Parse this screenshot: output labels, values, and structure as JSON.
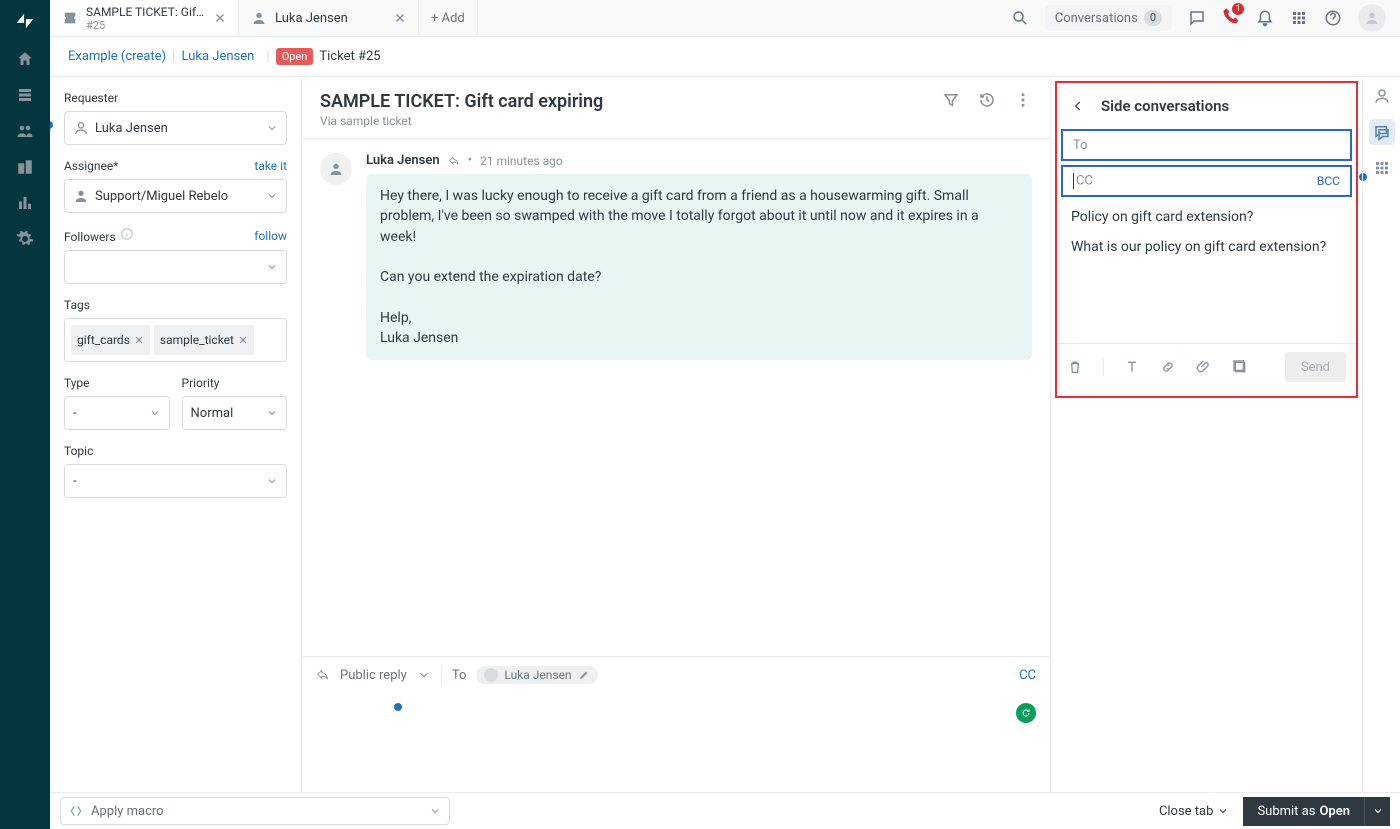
{
  "tabs": {
    "ticket_title": "SAMPLE TICKET: Gift car…",
    "ticket_sub": "#25",
    "user_title": "Luka Jensen",
    "add_label": "+  Add"
  },
  "topbar": {
    "conversations_label": "Conversations",
    "conversations_count": "0",
    "phone_badge": "1"
  },
  "breadcrumb": {
    "project": "Example (create)",
    "user": "Luka Jensen",
    "badge": "Open",
    "ticket": "Ticket #25"
  },
  "props": {
    "requester_label": "Requester",
    "requester_value": "Luka Jensen",
    "assignee_label": "Assignee*",
    "take_it": "take it",
    "assignee_value": "Support/Miguel Rebelo",
    "followers_label": "Followers",
    "follow": "follow",
    "tags_label": "Tags",
    "tags": [
      "gift_cards",
      "sample_ticket"
    ],
    "type_label": "Type",
    "type_value": "-",
    "priority_label": "Priority",
    "priority_value": "Normal",
    "topic_label": "Topic",
    "topic_value": "-"
  },
  "ticket": {
    "title": "SAMPLE TICKET: Gift card expiring",
    "via": "Via sample ticket"
  },
  "message": {
    "author": "Luka Jensen",
    "time": "21 minutes ago",
    "body": "Hey there, I was lucky enough to receive a gift card from a friend as a housewarming gift. Small problem, I've been so swamped with the move I totally forgot about it until now and it expires in a week!\n\nCan you extend the expiration date?\n\nHelp,\nLuka Jensen"
  },
  "reply": {
    "mode": "Public reply",
    "to_label": "To",
    "recipient": "Luka Jensen",
    "cc": "CC"
  },
  "sidepanel": {
    "title": "Side conversations",
    "to_placeholder": "To",
    "cc_placeholder": "CC",
    "bcc": "BCC",
    "subject": "Policy on gift card extension?",
    "body": "What is our policy on gift card extension?",
    "send": "Send"
  },
  "bottom": {
    "macro_placeholder": "Apply macro",
    "close_tab": "Close tab",
    "submit_prefix": "Submit as",
    "submit_status": "Open"
  }
}
